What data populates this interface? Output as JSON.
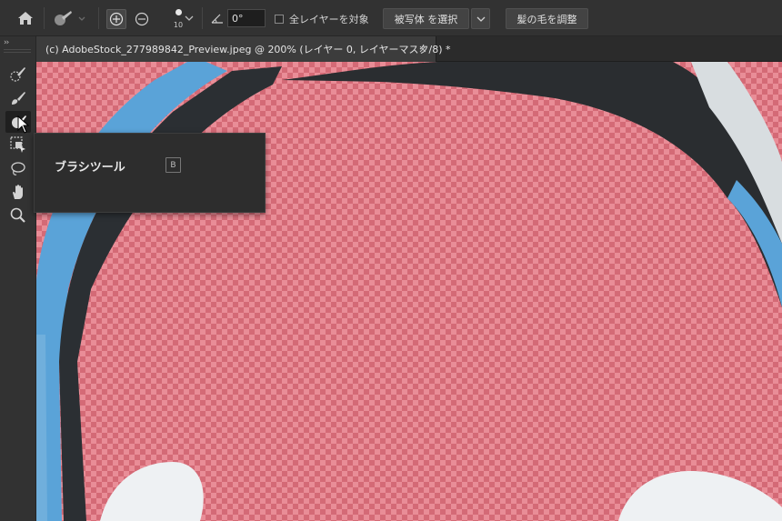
{
  "options_bar": {
    "brush_size": "10",
    "angle_value": "0°",
    "all_layers_label": "全レイヤーを対象",
    "select_subject_label": "被写体 を選択",
    "refine_hair_label": "髪の毛を調整"
  },
  "document": {
    "tab_title": "(c) AdobeStock_277989842_Preview.jpeg @ 200% (レイヤー 0, レイヤーマスク/8) *"
  },
  "toolbar": {
    "collapse_label": "››"
  },
  "tooltip": {
    "tool_name": "ブラシツール",
    "shortcut": "B"
  },
  "colors": {
    "ui_dark": "#323232",
    "overlay_red": "#e07a85",
    "headband_dark": "#2a2d30",
    "headband_blue": "#5aa3d8"
  }
}
